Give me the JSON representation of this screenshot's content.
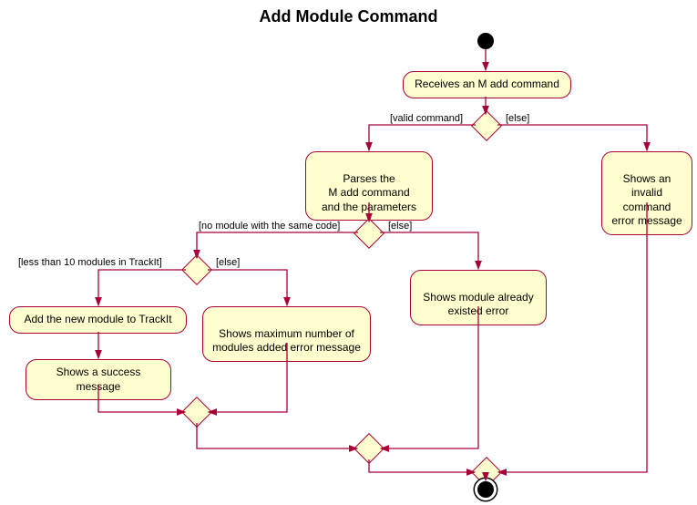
{
  "title": "Add Module Command",
  "nodes": {
    "receives": "Receives an M add command",
    "parses": "Parses the\nM add command\nand the parameters",
    "invalid": "Shows an\ninvalid command\nerror message",
    "exists": "Shows module already\nexisted error",
    "add": "Add the new module to TrackIt",
    "max": "Shows maximum number of\nmodules added error message",
    "success": "Shows a success message"
  },
  "guards": {
    "valid": "[valid command]",
    "else1": "[else]",
    "nomodule": "[no module with the same code]",
    "else2": "[else]",
    "less10": "[less than 10 modules in TrackIt]",
    "else3": "[else]"
  },
  "chart_data": {
    "type": "activity-diagram",
    "title": "Add Module Command",
    "start": "start",
    "end": "end",
    "nodes": [
      {
        "id": "start",
        "type": "initial"
      },
      {
        "id": "receives",
        "type": "action",
        "label": "Receives an M add command"
      },
      {
        "id": "d1",
        "type": "decision"
      },
      {
        "id": "parses",
        "type": "action",
        "label": "Parses the M add command and the parameters"
      },
      {
        "id": "invalid",
        "type": "action",
        "label": "Shows an invalid command error message"
      },
      {
        "id": "d2",
        "type": "decision"
      },
      {
        "id": "exists",
        "type": "action",
        "label": "Shows module already existed error"
      },
      {
        "id": "d3",
        "type": "decision"
      },
      {
        "id": "add",
        "type": "action",
        "label": "Add the new module to TrackIt"
      },
      {
        "id": "max",
        "type": "action",
        "label": "Shows maximum number of modules added error message"
      },
      {
        "id": "success",
        "type": "action",
        "label": "Shows a success message"
      },
      {
        "id": "m1",
        "type": "merge"
      },
      {
        "id": "m2",
        "type": "merge"
      },
      {
        "id": "m3",
        "type": "merge"
      },
      {
        "id": "end",
        "type": "final"
      }
    ],
    "edges": [
      {
        "from": "start",
        "to": "receives"
      },
      {
        "from": "receives",
        "to": "d1"
      },
      {
        "from": "d1",
        "to": "parses",
        "guard": "[valid command]"
      },
      {
        "from": "d1",
        "to": "invalid",
        "guard": "[else]"
      },
      {
        "from": "parses",
        "to": "d2"
      },
      {
        "from": "d2",
        "to": "d3",
        "guard": "[no module with the same code]"
      },
      {
        "from": "d2",
        "to": "exists",
        "guard": "[else]"
      },
      {
        "from": "d3",
        "to": "add",
        "guard": "[less than 10 modules in TrackIt]"
      },
      {
        "from": "d3",
        "to": "max",
        "guard": "[else]"
      },
      {
        "from": "add",
        "to": "success"
      },
      {
        "from": "success",
        "to": "m1"
      },
      {
        "from": "max",
        "to": "m1"
      },
      {
        "from": "m1",
        "to": "m2"
      },
      {
        "from": "exists",
        "to": "m2"
      },
      {
        "from": "m2",
        "to": "m3"
      },
      {
        "from": "invalid",
        "to": "m3"
      },
      {
        "from": "m3",
        "to": "end"
      }
    ]
  }
}
